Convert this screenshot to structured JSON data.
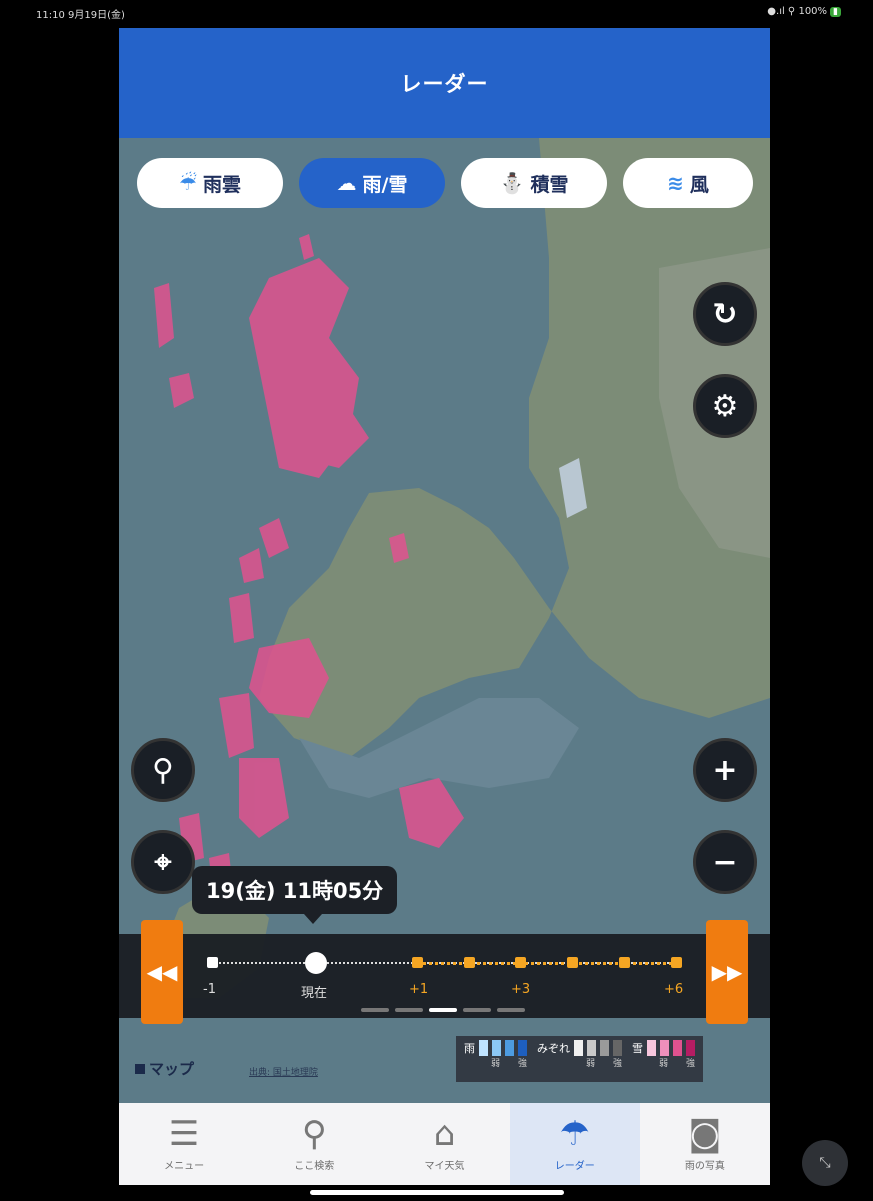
{
  "status": {
    "time": "11:10",
    "date": "9月19日(金)",
    "battery": "100%",
    "signal": "●.ıl ⚲"
  },
  "header": {
    "title": "レーダー"
  },
  "layers": [
    {
      "icon": "rain-cloud-icon",
      "glyph": "☔",
      "label": "雨雲",
      "active": false
    },
    {
      "icon": "rain-snow-icon",
      "glyph": "☁",
      "label": "雨/雪",
      "active": true
    },
    {
      "icon": "snow-depth-icon",
      "glyph": "⛄",
      "label": "積雪",
      "active": false
    },
    {
      "icon": "wind-icon",
      "glyph": "≋",
      "label": "風",
      "active": false
    }
  ],
  "controls": {
    "refresh": "↻",
    "settings": "⚙",
    "search": "⚲",
    "locate": "⌖",
    "zoom_in": "+",
    "zoom_out": "−"
  },
  "timeline": {
    "current_time": "19(金) 11時05分",
    "labels": {
      "minus1": "-1",
      "now": "現在",
      "p1": "+1",
      "p3": "+3",
      "p6": "+6"
    },
    "prev": "◀◀",
    "next": "▶▶"
  },
  "legend": {
    "rain": {
      "label": "雨",
      "low": "弱",
      "high": "強",
      "colors": [
        "#bfe3ff",
        "#8cc8f5",
        "#4d9be0",
        "#1e5fbf"
      ]
    },
    "sleet": {
      "label": "みぞれ",
      "low": "弱",
      "high": "強",
      "colors": [
        "#f0f0f0",
        "#c9c9c9",
        "#9a9a9a",
        "#666"
      ]
    },
    "snow": {
      "label": "雪",
      "low": "弱",
      "high": "強",
      "colors": [
        "#f7c6dd",
        "#ee8fbb",
        "#e0528f",
        "#b51d63"
      ]
    }
  },
  "map": {
    "label": "マップ",
    "attribution": "出典: 国土地理院"
  },
  "tabs": [
    {
      "icon": "menu-icon",
      "glyph": "☰",
      "label": "メニュー",
      "active": false
    },
    {
      "icon": "search-icon",
      "glyph": "⚲",
      "label": "ここ検索",
      "active": false
    },
    {
      "icon": "home-icon",
      "glyph": "⌂",
      "label": "マイ天気",
      "active": false
    },
    {
      "icon": "radar-icon",
      "glyph": "☂",
      "label": "レーダー",
      "active": true
    },
    {
      "icon": "camera-icon",
      "glyph": "◙",
      "label": "雨の写真",
      "active": false
    }
  ]
}
